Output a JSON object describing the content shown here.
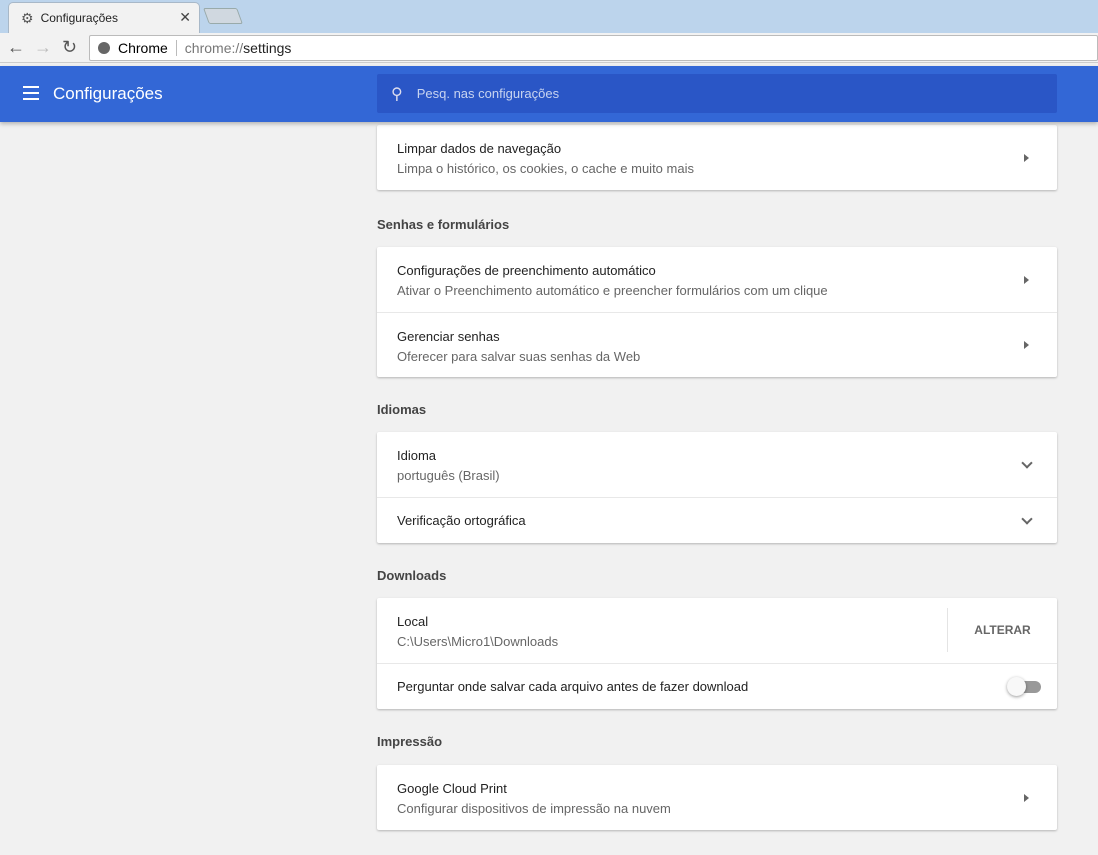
{
  "browser": {
    "tab_title": "Configurações",
    "omnibox_label": "Chrome",
    "url_scheme": "chrome://",
    "url_path": "settings"
  },
  "header": {
    "title": "Configurações",
    "search_placeholder": "Pesq. nas configurações"
  },
  "sections": {
    "privacy": {
      "items": [
        {
          "title": "Limpar dados de navegação",
          "subtitle": "Limpa o histórico, os cookies, o cache e muito mais"
        }
      ]
    },
    "passwords": {
      "title": "Senhas e formulários",
      "items": [
        {
          "title": "Configurações de preenchimento automático",
          "subtitle": "Ativar o Preenchimento automático e preencher formulários com um clique"
        },
        {
          "title": "Gerenciar senhas",
          "subtitle": "Oferecer para salvar suas senhas da Web"
        }
      ]
    },
    "languages": {
      "title": "Idiomas",
      "items": [
        {
          "title": "Idioma",
          "subtitle": "português (Brasil)"
        },
        {
          "title": "Verificação ortográfica"
        }
      ]
    },
    "downloads": {
      "title": "Downloads",
      "items": [
        {
          "title": "Local",
          "subtitle": "C:\\Users\\Micro1\\Downloads",
          "button": "ALTERAR"
        },
        {
          "title": "Perguntar onde salvar cada arquivo antes de fazer download",
          "toggle_on": false
        }
      ]
    },
    "printing": {
      "title": "Impressão",
      "items": [
        {
          "title": "Google Cloud Print",
          "subtitle": "Configurar dispositivos de impressão na nuvem"
        }
      ]
    }
  },
  "colors": {
    "header": "#3367d6",
    "search": "#2a56c6",
    "background": "#f1f1f1"
  }
}
